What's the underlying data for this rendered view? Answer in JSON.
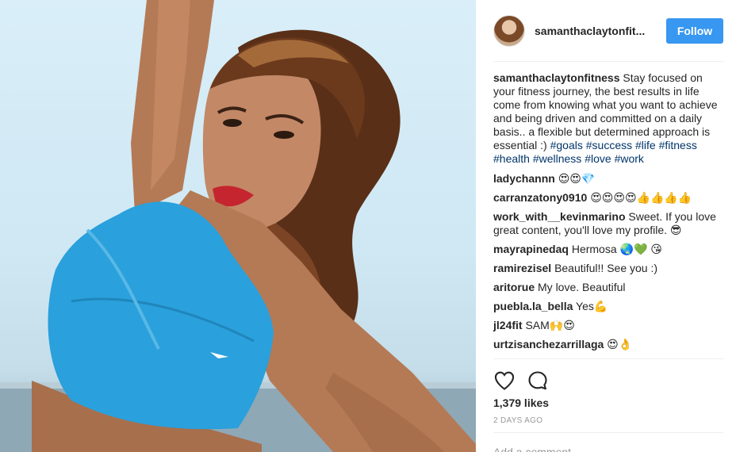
{
  "post": {
    "username_short": "samanthaclaytonfit...",
    "follow_label": "Follow",
    "likes": "1,379 likes",
    "time": "2 DAYS AGO",
    "add_comment_placeholder": "Add a comment..."
  },
  "caption": {
    "user": "samanthaclaytonfitness",
    "text": "Stay focused on your fitness journey, the best results in life come from knowing what you want to achieve and being driven and committed on a daily basis.. a flexible but determined approach is essential :)",
    "hashtags": [
      "#goals",
      "#success",
      "#life",
      "#fitness",
      "#health",
      "#wellness",
      "#love",
      "#work"
    ]
  },
  "comments": [
    {
      "user": "ladychannn",
      "text": "😍😍💎"
    },
    {
      "user": "carranzatony0910",
      "text": "😍😍😍😍👍👍👍👍"
    },
    {
      "user": "work_with__kevinmarino",
      "text": "Sweet. If you love great content, you'll love my profile. 😎"
    },
    {
      "user": "mayrapinedaq",
      "text": "Hermosa 🌏💚 😘"
    },
    {
      "user": "ramirezisel",
      "text": "Beautiful!! See you :)"
    },
    {
      "user": "aritorue",
      "text": "My love. Beautiful"
    },
    {
      "user": "puebla.la_bella",
      "text": "Yes💪"
    },
    {
      "user": "jl24fit",
      "text": "SAM🙌😍"
    },
    {
      "user": "urtzisanchezarrillaga",
      "text": "😍👌"
    }
  ],
  "colors": {
    "follow_button": "#3897f0",
    "hashtag": "#003569",
    "sports_bra": "#2aa0dc",
    "sky": "#d9eef8"
  },
  "icons": [
    "heart-icon",
    "comment-icon"
  ]
}
